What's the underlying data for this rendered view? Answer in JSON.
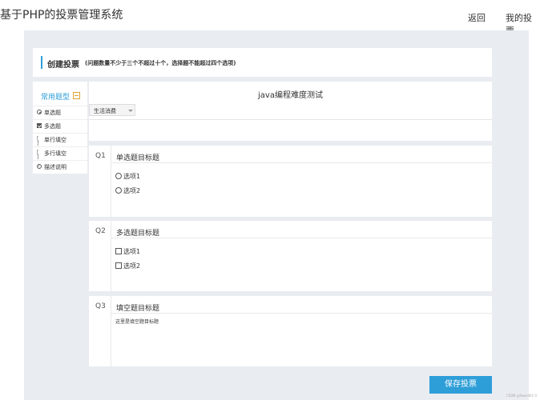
{
  "site": {
    "title": "基于PHP的投票管理系统"
  },
  "nav": {
    "back": "返回",
    "my_votes": "我的投票"
  },
  "header": {
    "title": "创建投票",
    "hint": "(问题数量不少于三个不超过十个，选择题不能超过四个选项)"
  },
  "sidebar": {
    "title": "常用题型",
    "items": [
      {
        "label": "单选题",
        "icon": "radio-icon"
      },
      {
        "label": "多选题",
        "icon": "checkbox-icon"
      },
      {
        "label": "单行填空",
        "icon": "single-line-icon"
      },
      {
        "label": "多行填空",
        "icon": "multi-line-icon"
      },
      {
        "label": "描述说明",
        "icon": "info-icon"
      }
    ]
  },
  "survey": {
    "title": "java编程难度测试",
    "category": "生活消费"
  },
  "questions": [
    {
      "number": "Q1",
      "title": "单选题目标题",
      "type": "radio",
      "options": [
        "选项1",
        "选项2"
      ]
    },
    {
      "number": "Q2",
      "title": "多选题目标题",
      "type": "checkbox",
      "options": [
        "选项1",
        "选项2"
      ]
    },
    {
      "number": "Q3",
      "title": "填空题目标题",
      "type": "text",
      "placeholder": "这里是填空题目标题"
    }
  ],
  "actions": {
    "save": "保存投票"
  },
  "footer": {
    "watermark": "CSDN @Sword01 0"
  },
  "colors": {
    "accent": "#2e9ed8",
    "workspace_bg": "#e9ecf1"
  }
}
